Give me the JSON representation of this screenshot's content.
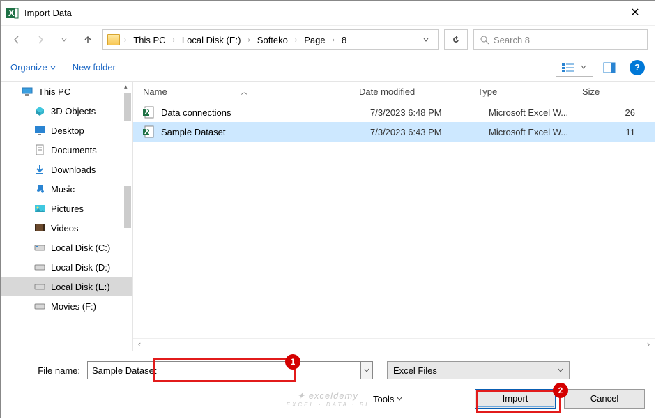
{
  "window": {
    "title": "Import Data"
  },
  "nav": {
    "breadcrumb": [
      "This PC",
      "Local Disk (E:)",
      "Softeko",
      "Page",
      "8"
    ],
    "search_placeholder": "Search 8"
  },
  "toolbar": {
    "organize": "Organize",
    "new_folder": "New folder"
  },
  "sidebar": {
    "items": [
      {
        "label": "This PC",
        "icon": "pc"
      },
      {
        "label": "3D Objects",
        "icon": "3d"
      },
      {
        "label": "Desktop",
        "icon": "desktop"
      },
      {
        "label": "Documents",
        "icon": "doc"
      },
      {
        "label": "Downloads",
        "icon": "down"
      },
      {
        "label": "Music",
        "icon": "music"
      },
      {
        "label": "Pictures",
        "icon": "pic"
      },
      {
        "label": "Videos",
        "icon": "video"
      },
      {
        "label": "Local Disk (C:)",
        "icon": "disk"
      },
      {
        "label": "Local Disk (D:)",
        "icon": "disk"
      },
      {
        "label": "Local Disk (E:)",
        "icon": "disk",
        "selected": true
      },
      {
        "label": "Movies (F:)",
        "icon": "disk"
      }
    ]
  },
  "columns": {
    "name": "Name",
    "date": "Date modified",
    "type": "Type",
    "size": "Size"
  },
  "files": [
    {
      "name": "Data connections",
      "date": "7/3/2023 6:48 PM",
      "type": "Microsoft Excel W...",
      "size": "26",
      "selected": false
    },
    {
      "name": "Sample Dataset",
      "date": "7/3/2023 6:43 PM",
      "type": "Microsoft Excel W...",
      "size": "11",
      "selected": true
    }
  ],
  "footer": {
    "filename_label": "File name:",
    "filename_value": "Sample Dataset",
    "filetype": "Excel Files",
    "tools": "Tools",
    "import": "Import",
    "cancel": "Cancel"
  },
  "annotations": {
    "badge1": "1",
    "badge2": "2"
  },
  "watermark": {
    "main": "exceldemy",
    "sub": "EXCEL · DATA · BI"
  }
}
